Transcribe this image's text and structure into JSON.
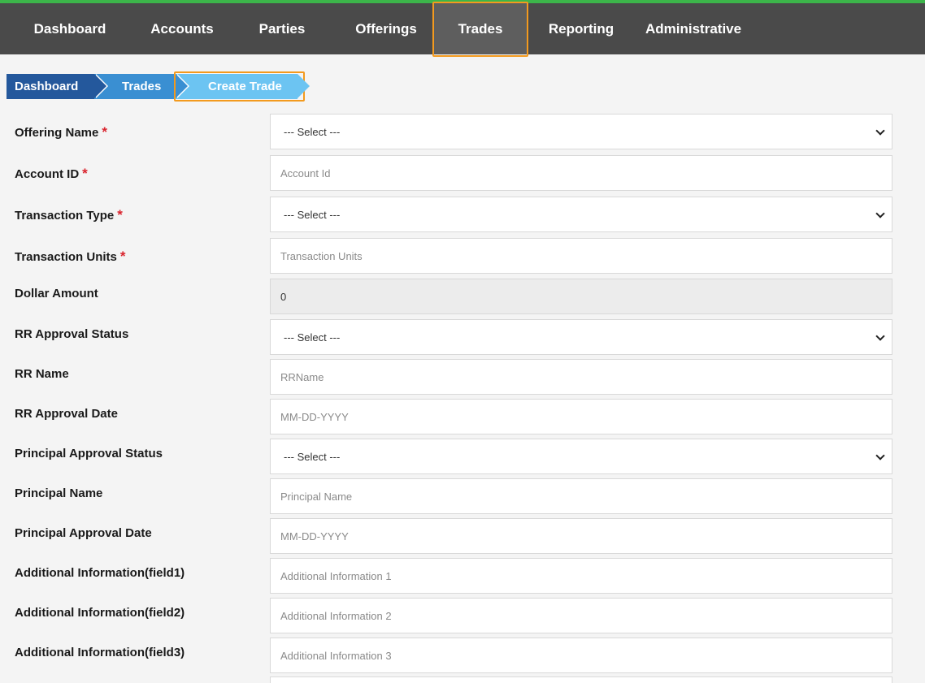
{
  "nav": {
    "items": [
      {
        "label": "Dashboard"
      },
      {
        "label": "Accounts"
      },
      {
        "label": "Parties"
      },
      {
        "label": "Offerings"
      },
      {
        "label": "Trades"
      },
      {
        "label": "Reporting"
      },
      {
        "label": "Administrative"
      }
    ],
    "active": "Trades"
  },
  "breadcrumb": {
    "items": [
      {
        "label": "Dashboard"
      },
      {
        "label": "Trades"
      },
      {
        "label": "Create Trade"
      }
    ]
  },
  "form": {
    "offering_name": {
      "label": "Offering Name",
      "value": "--- Select ---"
    },
    "account_id": {
      "label": "Account ID",
      "placeholder": "Account Id"
    },
    "transaction_type": {
      "label": "Transaction Type",
      "value": "--- Select ---"
    },
    "transaction_units": {
      "label": "Transaction Units",
      "placeholder": "Transaction Units"
    },
    "dollar_amount": {
      "label": "Dollar Amount",
      "value": "0"
    },
    "rr_approval_status": {
      "label": "RR Approval Status",
      "value": "--- Select ---"
    },
    "rr_name": {
      "label": "RR Name",
      "placeholder": "RRName"
    },
    "rr_approval_date": {
      "label": "RR Approval Date",
      "placeholder": "MM-DD-YYYY"
    },
    "principal_approval_status": {
      "label": "Principal Approval Status",
      "value": "--- Select ---"
    },
    "principal_name": {
      "label": "Principal Name",
      "placeholder": "Principal Name"
    },
    "principal_approval_date": {
      "label": "Principal Approval Date",
      "placeholder": "MM-DD-YYYY"
    },
    "additional_info_1": {
      "label": "Additional Information(field1)",
      "placeholder": "Additional Information 1"
    },
    "additional_info_2": {
      "label": "Additional Information(field2)",
      "placeholder": "Additional Information 2"
    },
    "additional_info_3": {
      "label": "Additional Information(field3)",
      "placeholder": "Additional Information 3"
    }
  },
  "required_marker": "*",
  "colors": {
    "nav_bg": "#4a4a4a",
    "nav_top_accent": "#3cb54a",
    "highlight": "#f39a1e",
    "crumb_1": "#24589c",
    "crumb_2": "#3a8fd2",
    "crumb_3": "#6cc4f2",
    "required": "#d9232d"
  }
}
